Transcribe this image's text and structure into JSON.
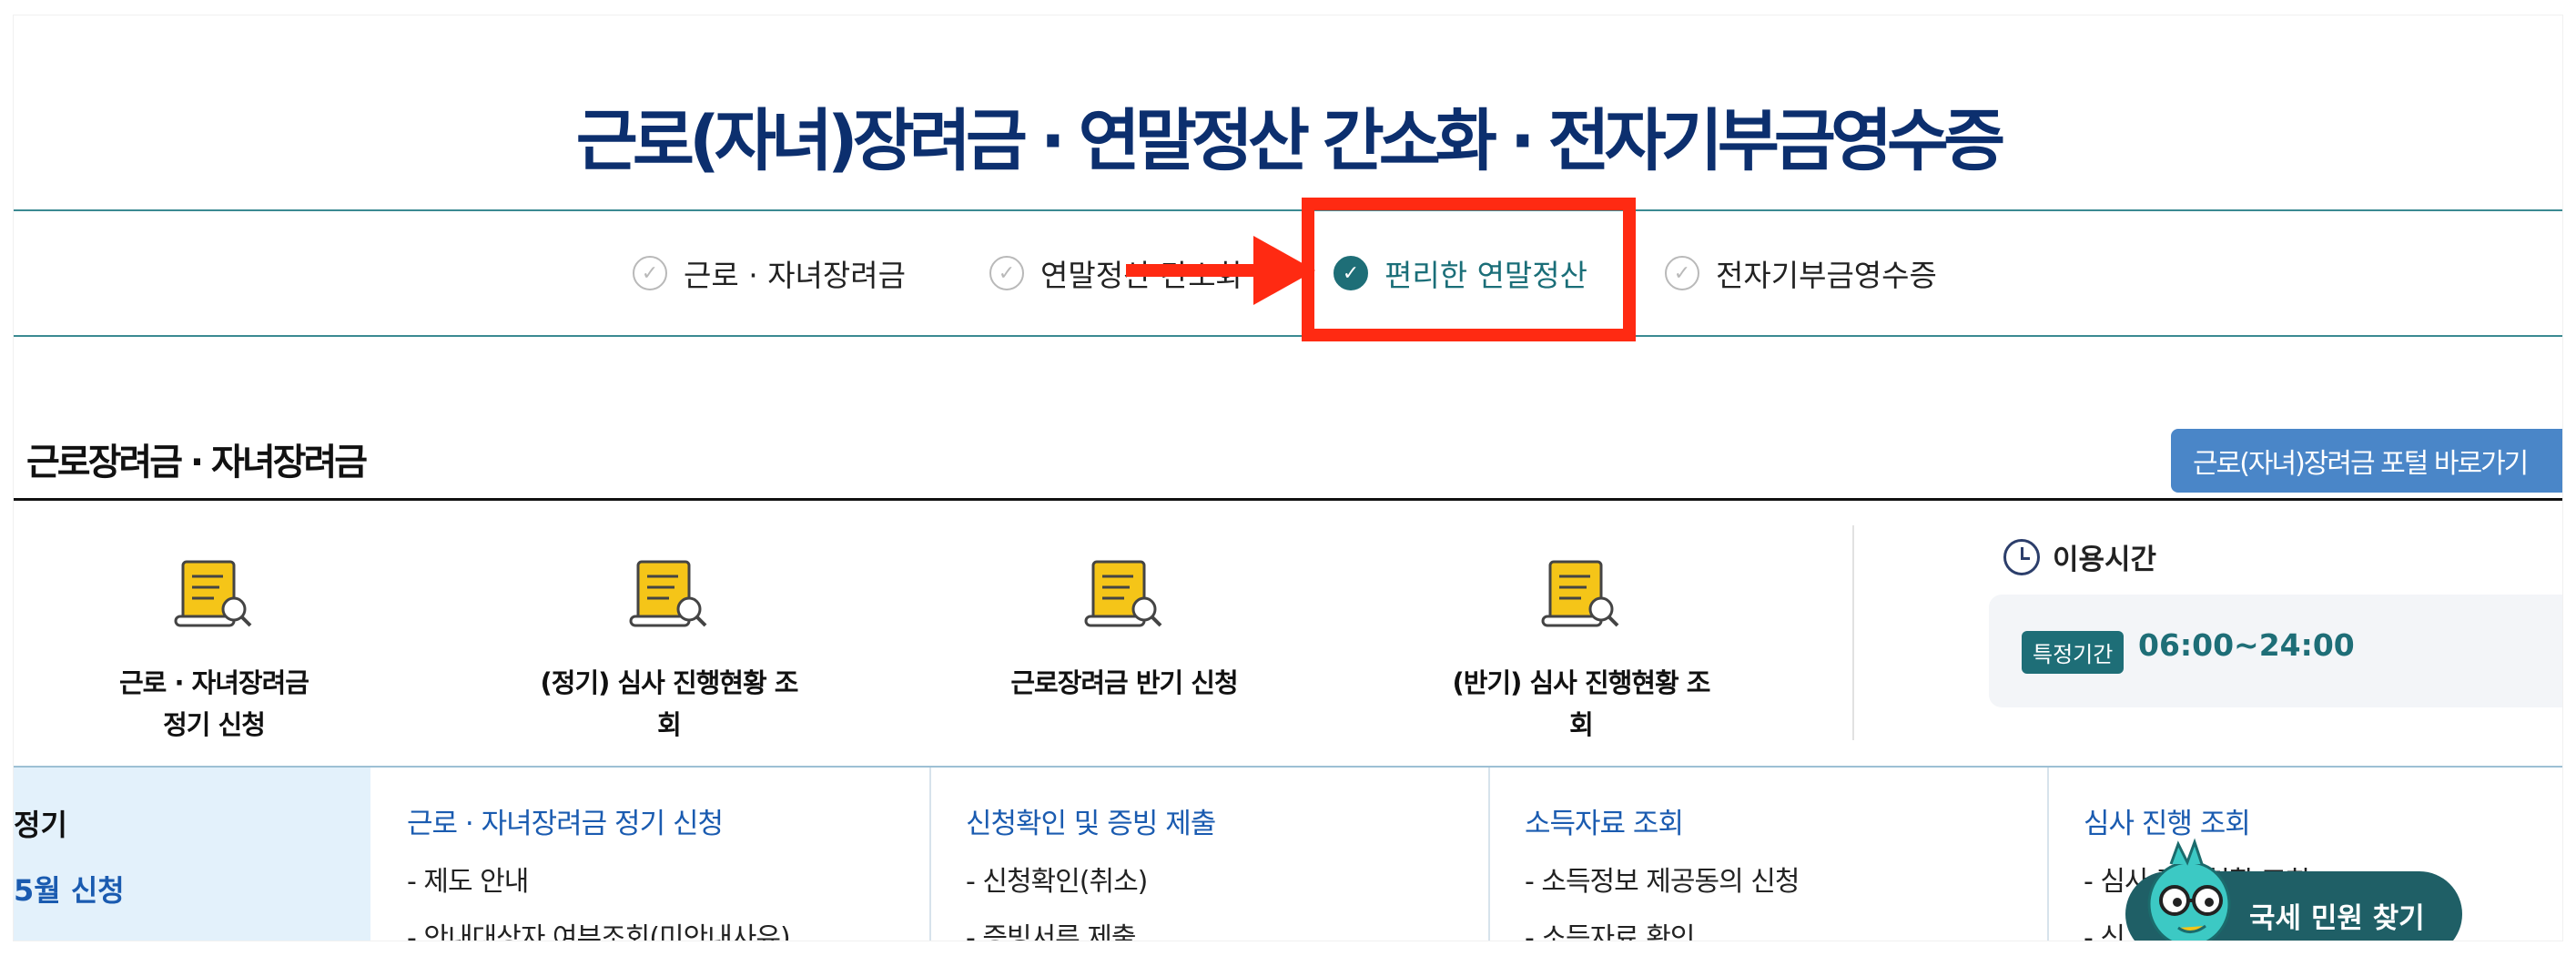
{
  "header": {
    "title": "근로(자녀)장려금 · 연말정산 간소화 · 전자기부금영수증"
  },
  "tabs": [
    {
      "label": "근로 · 자녀장려금",
      "active": false
    },
    {
      "label": "연말정산 간소화",
      "active": false
    },
    {
      "label": "편리한 연말정산",
      "active": true
    },
    {
      "label": "전자기부금영수증",
      "active": false
    }
  ],
  "annotation": {
    "highlight_color": "#ff2a12"
  },
  "section": {
    "title": "근로장려금 · 자녀장려금",
    "portal_button": "근로(자녀)장려금 포털 바로가기"
  },
  "services": [
    {
      "line1": "근로 · 자녀장려금",
      "line2": "정기 신청"
    },
    {
      "line1": "(정기) 심사 진행현황 조회",
      "line2": ""
    },
    {
      "line1": "근로장려금 반기 신청",
      "line2": ""
    },
    {
      "line1": "(반기) 심사 진행현황 조회",
      "line2": ""
    }
  ],
  "hours": {
    "title": "이용시간",
    "badge": "특정기간",
    "time": "06:00~24:00"
  },
  "grid": {
    "left_title": "정기",
    "left_sub": "5월 신청",
    "columns": [
      {
        "head": "근로 · 자녀장려금 정기 신청",
        "items": [
          "- 제도 안내",
          "- 안내대상자 여부조회(미안내사유)"
        ]
      },
      {
        "head": "신청확인 및 증빙 제출",
        "items": [
          "- 신청확인(취소)",
          "- 증빙서류 제출"
        ]
      },
      {
        "head": "소득자료 조회",
        "items": [
          "- 소득정보 제공동의 신청",
          "- 소득자료 확인"
        ]
      },
      {
        "head": "심사 진행 조회",
        "items": [
          "- 심사 진행현황 조회",
          "- 신"
        ]
      }
    ]
  },
  "floating_button": {
    "label": "국세 민원 찾기"
  },
  "colors": {
    "brand_navy": "#0c2f6e",
    "teal": "#1e6e77",
    "link_blue": "#1a5bb0",
    "portal_blue": "#4a86c8"
  }
}
